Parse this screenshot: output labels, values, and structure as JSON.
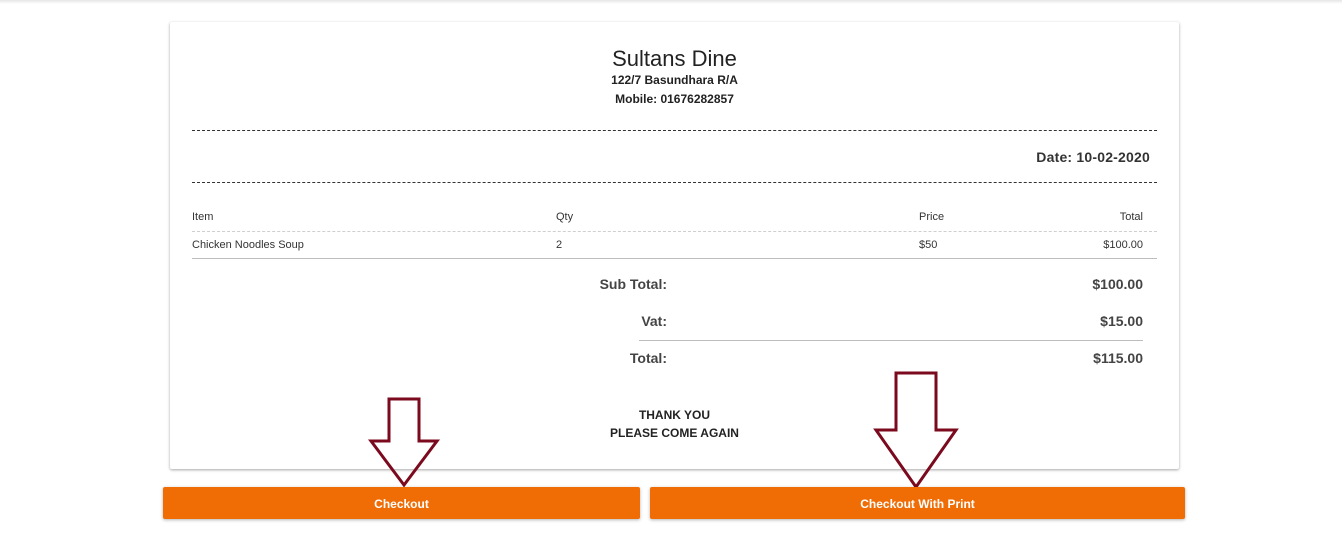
{
  "receipt": {
    "store_name": "Sultans Dine",
    "address": "122/7 Basundhara R/A",
    "mobile": "Mobile: 01676282857",
    "date": "Date: 10-02-2020",
    "columns": {
      "item": "Item",
      "qty": "Qty",
      "price": "Price",
      "total": "Total"
    },
    "items": [
      {
        "item": "Chicken Noodles Soup",
        "qty": "2",
        "price": "$50",
        "total": "$100.00"
      }
    ],
    "summary": {
      "subtotal_label": "Sub Total:",
      "subtotal_value": "$100.00",
      "vat_label": "Vat:",
      "vat_value": "$15.00",
      "total_label": "Total:",
      "total_value": "$115.00"
    },
    "thanks_line1": "THANK YOU",
    "thanks_line2": "PLEASE COME AGAIN"
  },
  "actions": {
    "checkout_label": "Checkout",
    "checkout_print_label": "Checkout With Print"
  },
  "colors": {
    "button": "#f06d06",
    "arrow": "#7b0a1e"
  },
  "icons": {
    "arrow_left": "down-arrow-icon",
    "arrow_right": "down-arrow-icon"
  }
}
